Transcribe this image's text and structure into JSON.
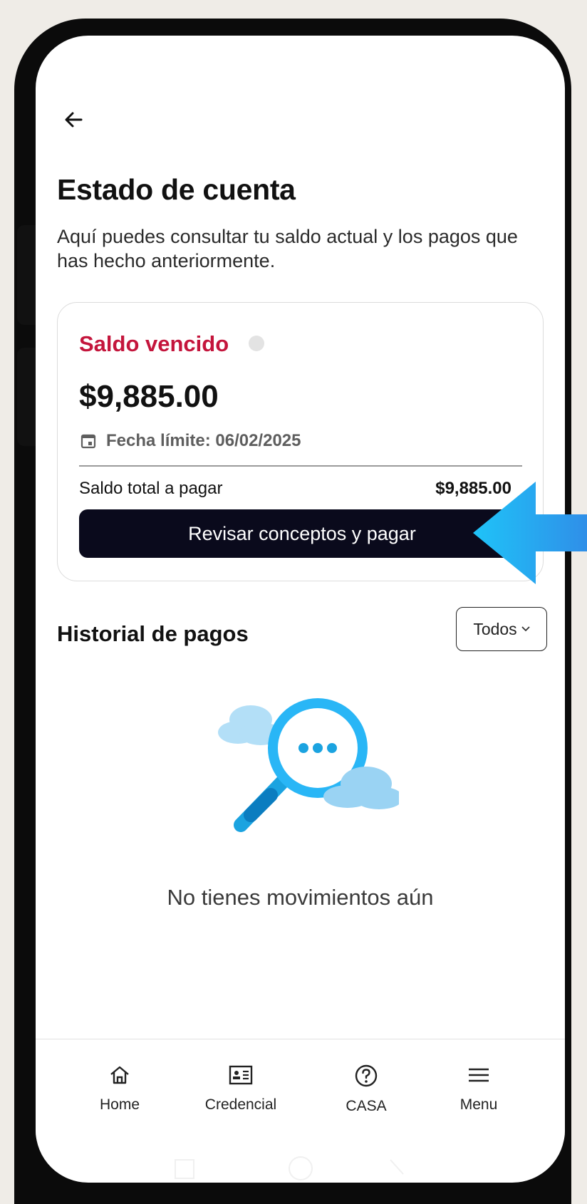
{
  "header": {
    "back_icon": "arrow-left-icon",
    "title": "Estado de cuenta",
    "subtitle": "Aquí puedes consultar tu saldo actual y los pagos que has hecho anteriormente."
  },
  "balance_card": {
    "status_label": "Saldo vencido",
    "status_color": "#c4153c",
    "info_icon": "info-icon",
    "amount": "$9,885.00",
    "due_icon": "calendar-icon",
    "due_date_text": "Fecha límite: 06/02/2025",
    "total_label": "Saldo total a pagar",
    "total_value": "$9,885.00",
    "pay_button_label": "Revisar conceptos y pagar"
  },
  "history": {
    "title": "Historial de pagos",
    "filter_label": "Todos",
    "filter_icon": "chevron-down-icon",
    "empty_icon": "magnifier-empty-icon",
    "empty_text": "No tienes movimientos aún"
  },
  "bottom_nav": {
    "items": [
      {
        "label": "Home",
        "icon": "home-icon"
      },
      {
        "label": "Credencial",
        "icon": "id-card-icon"
      },
      {
        "label": "CASA",
        "icon": "help-circle-icon"
      },
      {
        "label": "Menu",
        "icon": "hamburger-menu-icon"
      }
    ]
  },
  "annotation": {
    "pointer_icon": "blue-arrow-pointer-icon",
    "pointer_color": "#29b6f6"
  }
}
